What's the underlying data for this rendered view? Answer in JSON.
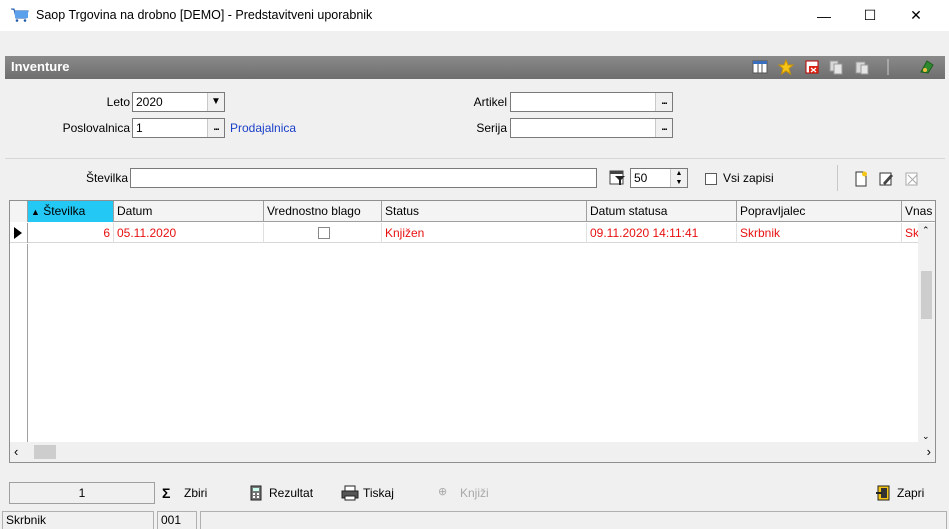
{
  "window": {
    "title": "Saop Trgovina na drobno [DEMO] - Predstavitveni uporabnik",
    "minimize_glyph": "—",
    "maximize_glyph": "☐",
    "close_glyph": "✕"
  },
  "section": {
    "title": "Inventure",
    "toolbar_icons": [
      "columns-icon",
      "star-icon",
      "close-red-icon",
      "copy-icon",
      "paste-icon",
      "exit-icon"
    ]
  },
  "filters": {
    "leto_label": "Leto",
    "leto_value": "2020",
    "poslovalnica_label": "Poslovalnica",
    "poslovalnica_value": "1",
    "poslovalnica_name": "Prodajalnica",
    "artikel_label": "Artikel",
    "artikel_value": "",
    "serija_label": "Serija",
    "serija_value": "",
    "ellipsis": "..."
  },
  "search": {
    "stevilka_label": "Številka",
    "stevilka_value": "",
    "limit_value": "50",
    "vsi_zapisi_label": "Vsi zapisi"
  },
  "grid": {
    "columns": [
      "Številka",
      "Datum",
      "Vrednostno blago",
      "Status",
      "Datum statusa",
      "Popravljalec",
      "Vnas"
    ],
    "rows": [
      {
        "stevilka": "6",
        "datum": "05.11.2020",
        "vrednostno_blago": false,
        "status": "Knjižen",
        "datum_statusa": "09.11.2020 14:11:41",
        "popravljalec": "Skrbnik",
        "vnasalec": "Skrb"
      }
    ],
    "row_color": "#e81010",
    "sorted_header_color": "#23c8f4"
  },
  "bottom": {
    "count": "1",
    "zbiri_label": "Zbiri",
    "rezultat_label": "Rezultat",
    "tiskaj_label": "Tiskaj",
    "knjizi_label": "Knjiži",
    "zapri_label": "Zapri"
  },
  "status": {
    "user": "Skrbnik",
    "code": "001"
  }
}
